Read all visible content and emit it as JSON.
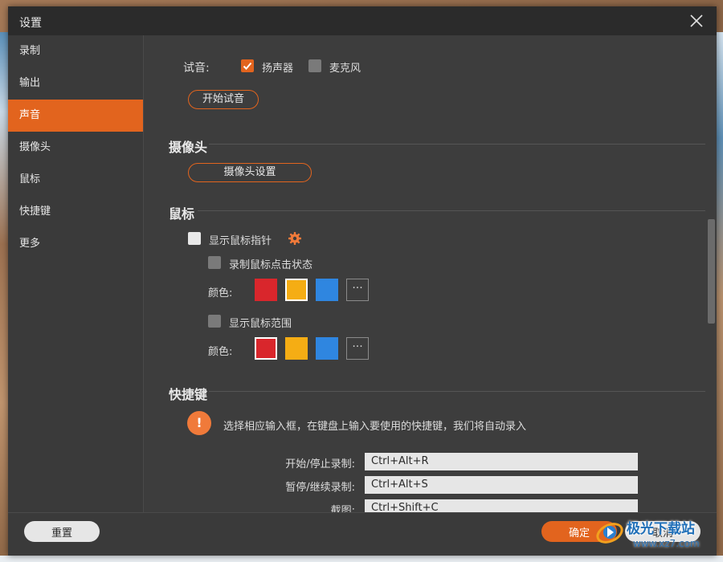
{
  "window": {
    "title": "设置"
  },
  "sidebar": {
    "items": [
      {
        "label": "录制"
      },
      {
        "label": "输出"
      },
      {
        "label": "声音",
        "active": true
      },
      {
        "label": "摄像头"
      },
      {
        "label": "鼠标"
      },
      {
        "label": "快捷键"
      },
      {
        "label": "更多"
      }
    ]
  },
  "sound": {
    "test_label": "试音:",
    "speaker_label": "扬声器",
    "speaker_checked": true,
    "mic_label": "麦克风",
    "mic_checked": false,
    "start_test_button": "开始试音"
  },
  "camera": {
    "title": "摄像头",
    "settings_button": "摄像头设置"
  },
  "mouse": {
    "title": "鼠标",
    "show_pointer_label": "显示鼠标指针",
    "record_click_label": "录制鼠标点击状态",
    "color_label_1": "颜色:",
    "show_range_label": "显示鼠标范围",
    "color_label_2": "颜色:",
    "colors": [
      "#d9262c",
      "#f5ad14",
      "#2f86e0"
    ],
    "more_colors": "···"
  },
  "hotkeys": {
    "title": "快捷键",
    "hint": "选择相应输入框，在键盘上输入要使用的快捷键，我们将自动录入",
    "hint_icon": "!",
    "items": [
      {
        "label": "开始/停止录制:",
        "value": "Ctrl+Alt+R"
      },
      {
        "label": "暂停/继续录制:",
        "value": "Ctrl+Alt+S"
      },
      {
        "label": "截图:",
        "value": "Ctrl+Shift+C"
      }
    ]
  },
  "footer": {
    "reset_button": "重置",
    "ok_button": "确定",
    "cancel_button": "取消"
  },
  "watermark": {
    "text": "极光下载站",
    "url": "www.xz7.com"
  },
  "colors": {
    "accent": "#e2641e",
    "panel_bg": "#3d3d3d",
    "titlebar_bg": "#2b2b2b"
  }
}
